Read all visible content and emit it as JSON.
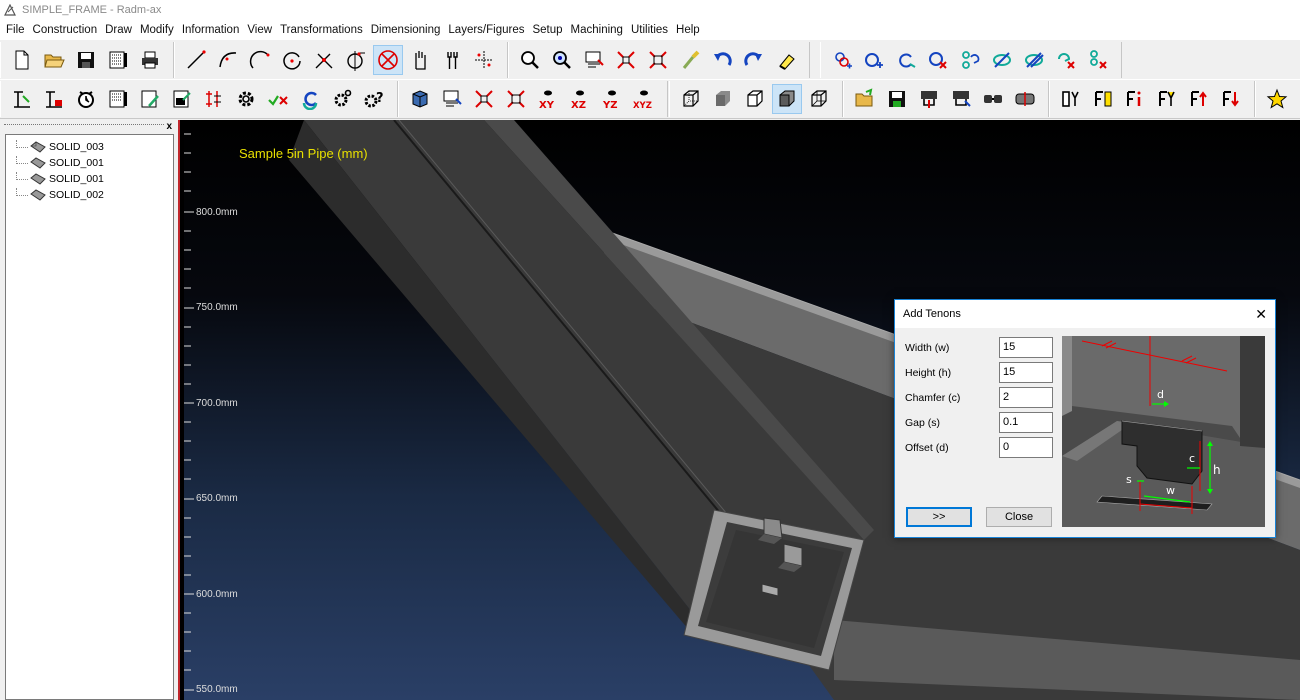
{
  "window": {
    "title": "SIMPLE_FRAME - Radm-ax"
  },
  "menu": [
    "File",
    "Construction",
    "Draw",
    "Modify",
    "Information",
    "View",
    "Transformations",
    "Dimensioning",
    "Layers/Figures",
    "Setup",
    "Machining",
    "Utilities",
    "Help"
  ],
  "tree": {
    "close_label": "x",
    "items": [
      "SOLID_003",
      "SOLID_001",
      "SOLID_001",
      "SOLID_002"
    ]
  },
  "viewport": {
    "label": "Sample 5in Pipe (mm)",
    "ruler_labels": [
      "800.0mm",
      "750.0mm",
      "700.0mm",
      "650.0mm",
      "600.0mm",
      "550.0mm"
    ],
    "colors": {
      "label": "#e8e000",
      "background_top": "#000000",
      "background_bottom": "#2a3f66"
    }
  },
  "dialog": {
    "title": "Add Tenons",
    "close_label": "✕",
    "fields": [
      {
        "label": "Width (w)",
        "value": "15"
      },
      {
        "label": "Height (h)",
        "value": "15"
      },
      {
        "label": "Chamfer (c)",
        "value": "2"
      },
      {
        "label": "Gap (s)",
        "value": "0.1"
      },
      {
        "label": "Offset (d)",
        "value": "0"
      }
    ],
    "next_label": ">>",
    "close_button_label": "Close",
    "diagram_labels": {
      "d": "d",
      "c": "c",
      "h": "h",
      "s": "s",
      "w": "w"
    }
  },
  "toolbar2_texts": {
    "xy": "XY",
    "xz": "XZ",
    "yz": "YZ",
    "xyz": "XYZ"
  }
}
